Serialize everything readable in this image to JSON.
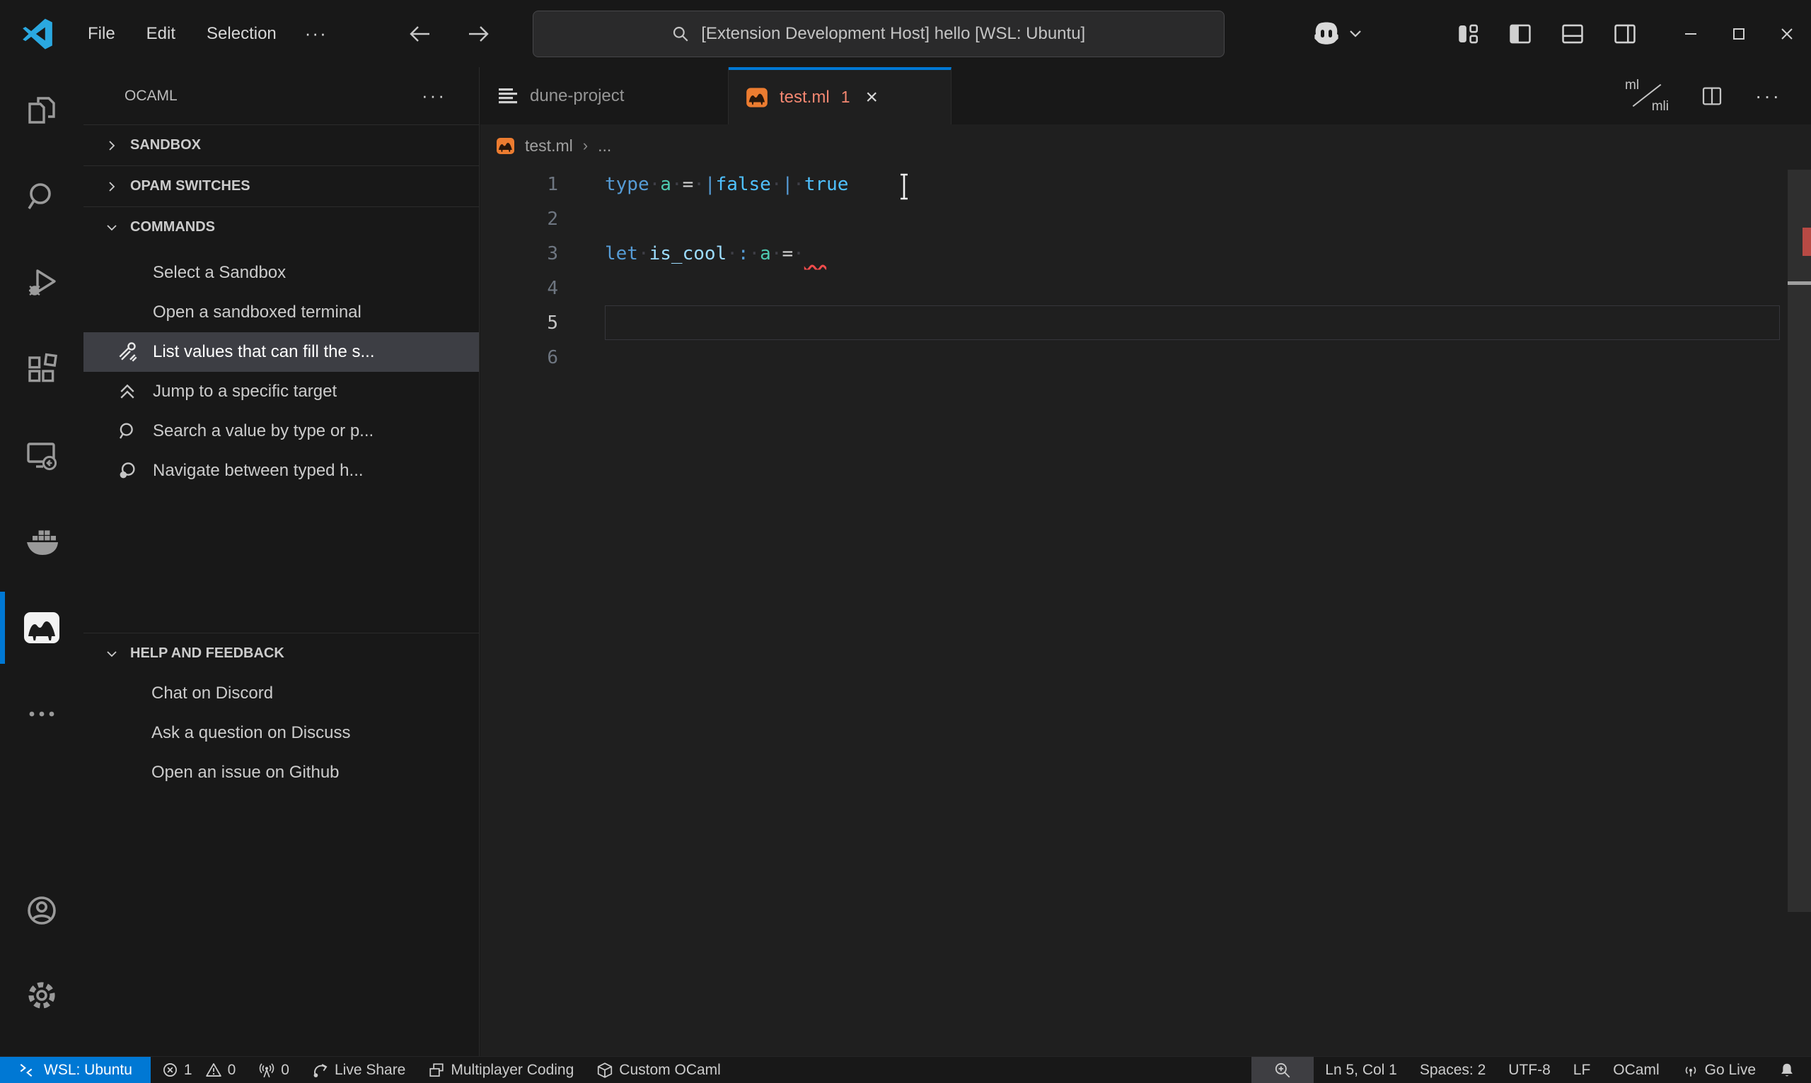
{
  "title_bar": {
    "menus": [
      "File",
      "Edit",
      "Selection"
    ],
    "menu_overflow": "···",
    "command_center_text": "[Extension Development Host] hello [WSL: Ubuntu]"
  },
  "sidebar": {
    "title": "OCAML",
    "more": "···",
    "sections": [
      {
        "label": "SANDBOX"
      },
      {
        "label": "OPAM SWITCHES"
      },
      {
        "label": "COMMANDS"
      }
    ],
    "commands": [
      {
        "label": "Select a Sandbox"
      },
      {
        "label": "Open a sandboxed terminal"
      },
      {
        "label": "List values that can fill the s..."
      },
      {
        "label": "Jump to a specific target"
      },
      {
        "label": "Search a value by type or p..."
      },
      {
        "label": "Navigate between typed h..."
      }
    ],
    "help_section": {
      "label": "HELP AND FEEDBACK"
    },
    "help_items": [
      {
        "label": "Chat on Discord"
      },
      {
        "label": "Ask a question on Discuss"
      },
      {
        "label": "Open an issue on Github"
      }
    ]
  },
  "editor": {
    "tabs": [
      {
        "label": "dune-project"
      },
      {
        "label": "test.ml",
        "badge": "1",
        "close": "×"
      }
    ],
    "actions": {
      "ml": "ml",
      "mli": "mli",
      "more": "···"
    },
    "breadcrumb": {
      "file": "test.ml",
      "separator": "›",
      "more": "..."
    },
    "lines": [
      {
        "num": "1",
        "tokens": [
          {
            "t": "type",
            "c": "#569cd6"
          },
          {
            "t": "·",
            "c": "#3e3e46"
          },
          {
            "t": "a",
            "c": "#4ec9b0"
          },
          {
            "t": "·",
            "c": "#3e3e46"
          },
          {
            "t": "=",
            "c": "#d4d4d4"
          },
          {
            "t": "·",
            "c": "#3e3e46"
          },
          {
            "t": "|",
            "c": "#569cd6"
          },
          {
            "t": "false",
            "c": "#4fc1ff"
          },
          {
            "t": "·",
            "c": "#3e3e46"
          },
          {
            "t": "|",
            "c": "#569cd6"
          },
          {
            "t": "·",
            "c": "#3e3e46"
          },
          {
            "t": "true",
            "c": "#4fc1ff"
          }
        ]
      },
      {
        "num": "2",
        "tokens": []
      },
      {
        "num": "3",
        "tokens": [
          {
            "t": "let",
            "c": "#569cd6"
          },
          {
            "t": "·",
            "c": "#3e3e46"
          },
          {
            "t": "is_cool",
            "c": "#9cdcfe"
          },
          {
            "t": "·",
            "c": "#3e3e46"
          },
          {
            "t": ":",
            "c": "#569cd6"
          },
          {
            "t": "·",
            "c": "#3e3e46"
          },
          {
            "t": "a",
            "c": "#4ec9b0"
          },
          {
            "t": "·",
            "c": "#3e3e46"
          },
          {
            "t": "=",
            "c": "#d4d4d4"
          },
          {
            "t": "·",
            "c": "#3e3e46"
          },
          {
            "t": "  ",
            "cls": "squiggle"
          }
        ]
      },
      {
        "num": "4",
        "tokens": []
      },
      {
        "num": "5",
        "tokens": []
      },
      {
        "num": "6",
        "tokens": []
      }
    ]
  },
  "status_bar": {
    "remote_label": "WSL: Ubuntu",
    "error_count": "1",
    "warning_count": "0",
    "port_count": "0",
    "live_share": "Live Share",
    "multiplayer": "Multiplayer Coding",
    "custom_ocaml": "Custom OCaml",
    "cursor_position": "Ln 5, Col 1",
    "indentation": "Spaces: 2",
    "encoding": "UTF-8",
    "eol": "LF",
    "language": "OCaml",
    "go_live": "Go Live"
  },
  "colors": {
    "accent": "#0078d4",
    "error": "#f14c4c",
    "tab_error_foreground": "#f48771",
    "camel_orange": "#ec7c30"
  }
}
